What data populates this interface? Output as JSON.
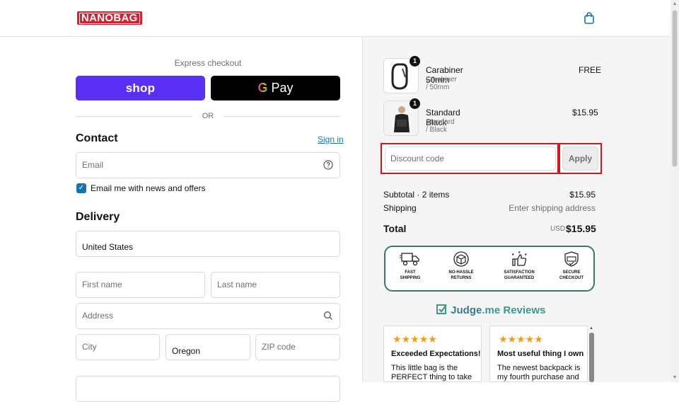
{
  "header": {
    "logo_text": "NANOBAG",
    "cart_icon": "shopping-bag-icon"
  },
  "checkout": {
    "express_label": "Express checkout",
    "shop_pay_label": "shop",
    "gpay_g": "G",
    "gpay_label": " Pay",
    "or_label": "OR",
    "contact": {
      "heading": "Contact",
      "signin_label": "Sign in",
      "email_placeholder": "Email",
      "newsletter_label": "Email me with news and offers",
      "newsletter_checked": true
    },
    "delivery": {
      "heading": "Delivery",
      "country_value": "United States",
      "first_name_placeholder": "First name",
      "last_name_placeholder": "Last name",
      "address_placeholder": "Address",
      "city_placeholder": "City",
      "state_value": "Oregon",
      "zip_placeholder": "ZIP code"
    }
  },
  "summary": {
    "items": [
      {
        "name": "Carabiner 50mm",
        "variant": "Carabiner / 50mm",
        "price": "FREE",
        "quantity": "1"
      },
      {
        "name": "Standard Black",
        "variant": "Standard / Black",
        "price": "$15.95",
        "quantity": "1"
      }
    ],
    "discount_placeholder": "Discount code",
    "apply_label": "Apply",
    "subtotal_label": "Subtotal · 2 items",
    "subtotal_value": "$15.95",
    "shipping_label": "Shipping",
    "shipping_value": "Enter shipping address",
    "total_label": "Total",
    "total_currency": "USD",
    "total_value": "$15.95"
  },
  "trust_badges": [
    {
      "label": "FAST\nSHIPPING",
      "icon": "truck-icon"
    },
    {
      "label": "NO-HASSLE\nRETURNS",
      "icon": "return-box-icon"
    },
    {
      "label": "SATISFACTION\nGUARANTEED",
      "icon": "thumbs-up-icon"
    },
    {
      "label": "SECURE\nCHECKOUT",
      "icon": "shield-check-icon"
    }
  ],
  "reviews": {
    "brand_prefix": "Judge",
    "brand_suffix": ".me Reviews",
    "items": [
      {
        "stars": "★★★★★",
        "title": "Exceeded Expectations!",
        "text": "This little bag is the PERFECT thing to take"
      },
      {
        "stars": "★★★★★",
        "title": "Most useful thing I own",
        "text": "The newest backpack is my fourth purchase and"
      }
    ]
  },
  "colors": {
    "shop_pay": "#5a31f4",
    "link": "#1773b0",
    "highlight": "#d8141e",
    "trust_border": "#3b7a5e",
    "brand": "#d6202f"
  }
}
